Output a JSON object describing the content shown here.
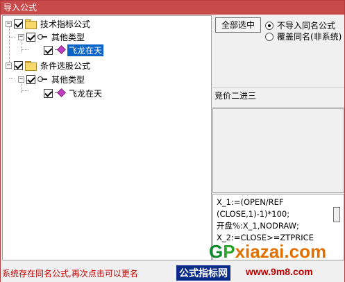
{
  "window": {
    "title": "导入公式"
  },
  "tree": {
    "nodes": [
      {
        "label": "技术指标公式",
        "type": "folder",
        "expanded": true,
        "checked": true
      },
      {
        "label": "其他类型",
        "type": "key",
        "expanded": true,
        "checked": true
      },
      {
        "label": "飞龙在天",
        "type": "formula",
        "checked": true,
        "selected": true
      },
      {
        "label": "条件选股公式",
        "type": "folder",
        "expanded": true,
        "checked": true
      },
      {
        "label": "其他类型",
        "type": "key",
        "expanded": true,
        "checked": true
      },
      {
        "label": "飞龙在天",
        "type": "formula",
        "checked": true,
        "selected": false
      }
    ],
    "expander_symbol": "−"
  },
  "actions": {
    "select_all_label": "全部选中"
  },
  "options": {
    "no_import_same_name": {
      "label": "不导入同名公式",
      "checked": true
    },
    "overwrite_same_name": {
      "label": "覆盖同名(非系统)",
      "checked": false
    }
  },
  "formula_name": "竞价二进三",
  "formula_code": [
    "X_1:=(OPEN/REF",
    "(CLOSE,1)-1)*100;",
    "开盘%:X_1,NODRAW;",
    "X_2:=CLOSE>=ZTPRICE"
  ],
  "status": {
    "message": "系统存在同名公式,再次点击可以更名"
  },
  "watermark": {
    "site_letters": [
      "G",
      "P",
      "xiazai",
      ".com"
    ],
    "badge_text": "公式指标网",
    "url_text": "www.9m8.com"
  },
  "colors": {
    "titlebar": "#c94a4a",
    "selection": "#0a64c8",
    "status_text": "#c00000"
  }
}
